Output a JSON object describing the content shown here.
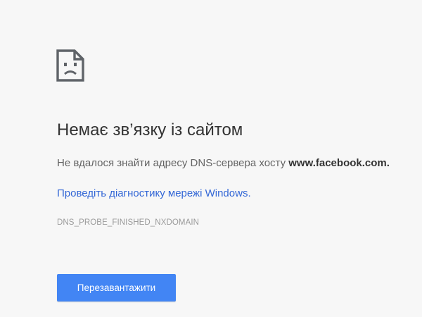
{
  "error_page": {
    "icon": "sad-page-icon",
    "heading": "Немає зв’язку із сайтом",
    "summary_prefix": "Не вдалося знайти адресу DNS-сервера хосту ",
    "summary_host": "www.facebook.com.",
    "diagnostics_link": "Проведіть діагностику мережі Windows.",
    "error_code": "DNS_PROBE_FINISHED_NXDOMAIN",
    "reload_label": "Перезавантажити"
  },
  "colors": {
    "background": "#f7f7f7",
    "heading": "#333333",
    "body_text": "#646464",
    "link": "#3367d6",
    "error_code": "#9a9a9a",
    "button": "#4285f4",
    "button_text": "#ffffff"
  }
}
